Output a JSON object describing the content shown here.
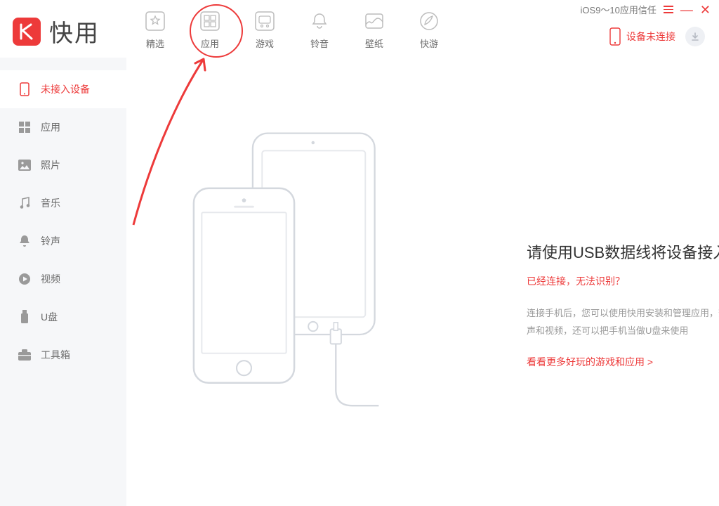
{
  "brand": {
    "name": "快用"
  },
  "nav": {
    "featured": "精选",
    "apps": "应用",
    "games": "游戏",
    "ringtones": "铃音",
    "wallpaper": "壁纸",
    "quickplay": "快游"
  },
  "titlebar": {
    "trust": "iOS9～10应用信任"
  },
  "device_status": {
    "label": "设备未连接"
  },
  "sidebar": {
    "no_device": "未接入设备",
    "apps": "应用",
    "photos": "照片",
    "music": "音乐",
    "ringtones": "铃声",
    "video": "视频",
    "udisk": "U盘",
    "toolbox": "工具箱"
  },
  "main": {
    "heading": "请使用USB数据线将设备接入电脑",
    "help_link": "已经连接，无法识别？",
    "desc": "连接手机后，您可以使用快用安装和管理应用，查看图片、音乐、铃声和视频，还可以把手机当做U盘来使用",
    "more_link": "看看更多好玩的游戏和应用 >"
  }
}
